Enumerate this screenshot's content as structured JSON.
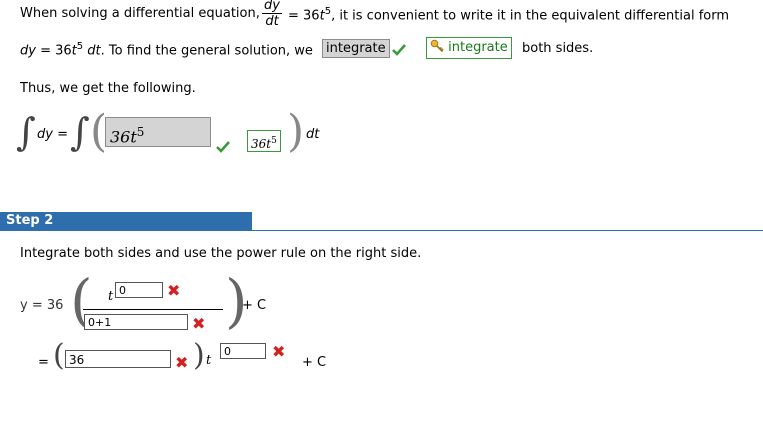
{
  "step1": {
    "intro": "When solving a differential equation,",
    "deq_num": "dy",
    "deq_den": "dt",
    "deq_rhs_pre": "= 36",
    "deq_var": "t",
    "deq_exp": "5",
    "intro_tail": ", it is convenient to write it in the equivalent differential form",
    "line2_dy": "dy",
    "line2_eq": "= 36",
    "line2_var": "t",
    "line2_exp": "5",
    "line2_dt": " dt",
    "line2_text": ". To find the general solution, we",
    "answer_value": "integrate",
    "answer_correct": "integrate",
    "line2_tail": "both sides.",
    "thus": "Thus, we get the following.",
    "int_dy": "dy =",
    "int_input_value": "36t⁵",
    "int_input_text": "36t",
    "int_input_exp": "5",
    "int_correct_text": "36t",
    "int_correct_exp": "5",
    "int_dt": "dt"
  },
  "step2": {
    "header": "Step 2",
    "instruction": "Integrate both sides and use the power rule on the right side.",
    "y_eq": "y  =  36",
    "t_var": "t",
    "exp_input": "0",
    "den_input": "0+1",
    "plus_c": "+ C",
    "eq2": "=",
    "coef_input": "36",
    "t_var2": "t",
    "exp_input2": "0",
    "plus_c2": "+ C"
  },
  "colors": {
    "step_bar": "#2f6ead",
    "correct_green": "#3a9a3a",
    "wrong_red": "#d42020",
    "input_grey": "#d4d4d4"
  }
}
